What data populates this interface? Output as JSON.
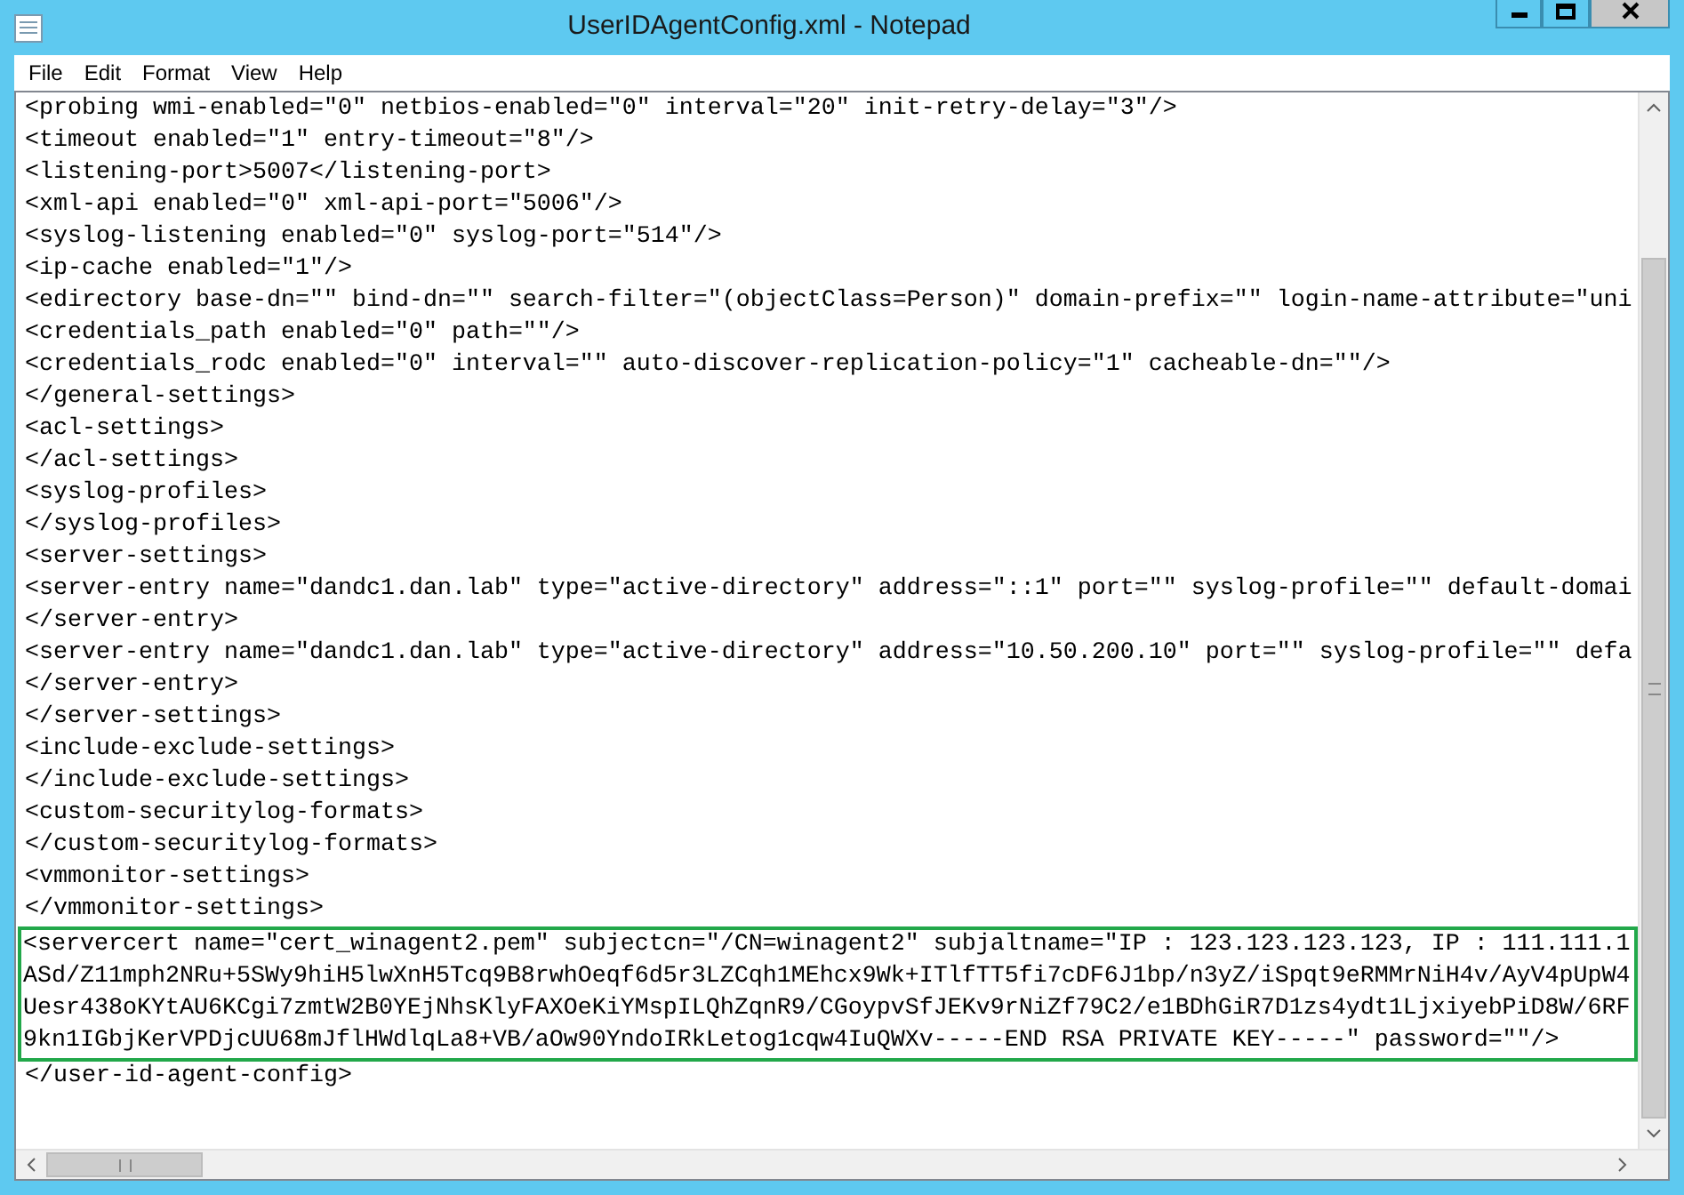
{
  "window": {
    "title": "UserIDAgentConfig.xml - Notepad"
  },
  "menu": [
    "File",
    "Edit",
    "Format",
    "View",
    "Help"
  ],
  "editor": {
    "lines": [
      {
        "text": "<probing wmi-enabled=\"0\" netbios-enabled=\"0\" interval=\"20\" init-retry-delay=\"3\"/>",
        "highlighted": false
      },
      {
        "text": "<timeout enabled=\"1\" entry-timeout=\"8\"/>",
        "highlighted": false
      },
      {
        "text": "<listening-port>5007</listening-port>",
        "highlighted": false
      },
      {
        "text": "<xml-api enabled=\"0\" xml-api-port=\"5006\"/>",
        "highlighted": false
      },
      {
        "text": "<syslog-listening enabled=\"0\" syslog-port=\"514\"/>",
        "highlighted": false
      },
      {
        "text": "<ip-cache enabled=\"1\"/>",
        "highlighted": false
      },
      {
        "text": "<edirectory base-dn=\"\" bind-dn=\"\" search-filter=\"(objectClass=Person)\" domain-prefix=\"\" login-name-attribute=\"uni",
        "highlighted": false
      },
      {
        "text": "<credentials_path enabled=\"0\" path=\"\"/>",
        "highlighted": false
      },
      {
        "text": "<credentials_rodc enabled=\"0\" interval=\"\" auto-discover-replication-policy=\"1\" cacheable-dn=\"\"/>",
        "highlighted": false
      },
      {
        "text": "</general-settings>",
        "highlighted": false
      },
      {
        "text": "<acl-settings>",
        "highlighted": false
      },
      {
        "text": "</acl-settings>",
        "highlighted": false
      },
      {
        "text": "<syslog-profiles>",
        "highlighted": false
      },
      {
        "text": "</syslog-profiles>",
        "highlighted": false
      },
      {
        "text": "<server-settings>",
        "highlighted": false
      },
      {
        "text": "<server-entry name=\"dandc1.dan.lab\" type=\"active-directory\" address=\"::1\" port=\"\" syslog-profile=\"\" default-domai",
        "highlighted": false
      },
      {
        "text": "</server-entry>",
        "highlighted": false
      },
      {
        "text": "<server-entry name=\"dandc1.dan.lab\" type=\"active-directory\" address=\"10.50.200.10\" port=\"\" syslog-profile=\"\" defa",
        "highlighted": false
      },
      {
        "text": "</server-entry>",
        "highlighted": false
      },
      {
        "text": "</server-settings>",
        "highlighted": false
      },
      {
        "text": "<include-exclude-settings>",
        "highlighted": false
      },
      {
        "text": "</include-exclude-settings>",
        "highlighted": false
      },
      {
        "text": "<custom-securitylog-formats>",
        "highlighted": false
      },
      {
        "text": "</custom-securitylog-formats>",
        "highlighted": false
      },
      {
        "text": "<vmmonitor-settings>",
        "highlighted": false
      },
      {
        "text": "</vmmonitor-settings>",
        "highlighted": false
      },
      {
        "text": "<servercert name=\"cert_winagent2.pem\" subjectcn=\"/CN=winagent2\" subjaltname=\"IP : 123.123.123.123, IP : 111.111.1",
        "highlighted": true
      },
      {
        "text": "ASd/Z11mph2NRu+5SWy9hiH5lwXnH5Tcq9B8rwhOeqf6d5r3LZCqh1MEhcx9Wk+ITlfTT5fi7cDF6J1bp/n3yZ/iSpqt9eRMMrNiH4v/AyV4pUpW4",
        "highlighted": true
      },
      {
        "text": "Uesr438oKYtAU6KCgi7zmtW2B0YEjNhsKlyFAXOeKiYMspILQhZqnR9/CGoypvSfJEKv9rNiZf79C2/e1BDhGiR7D1zs4ydt1LjxiyebPiD8W/6RF",
        "highlighted": true
      },
      {
        "text": "9kn1IGbjKerVPDjcUU68mJflHWdlqLa8+VB/aOw90YndoIRkLetog1cqw4IuQWXv-----END RSA PRIVATE KEY-----\" password=\"\"/>",
        "highlighted": true
      },
      {
        "text": "</user-id-agent-config>",
        "highlighted": false
      }
    ]
  }
}
